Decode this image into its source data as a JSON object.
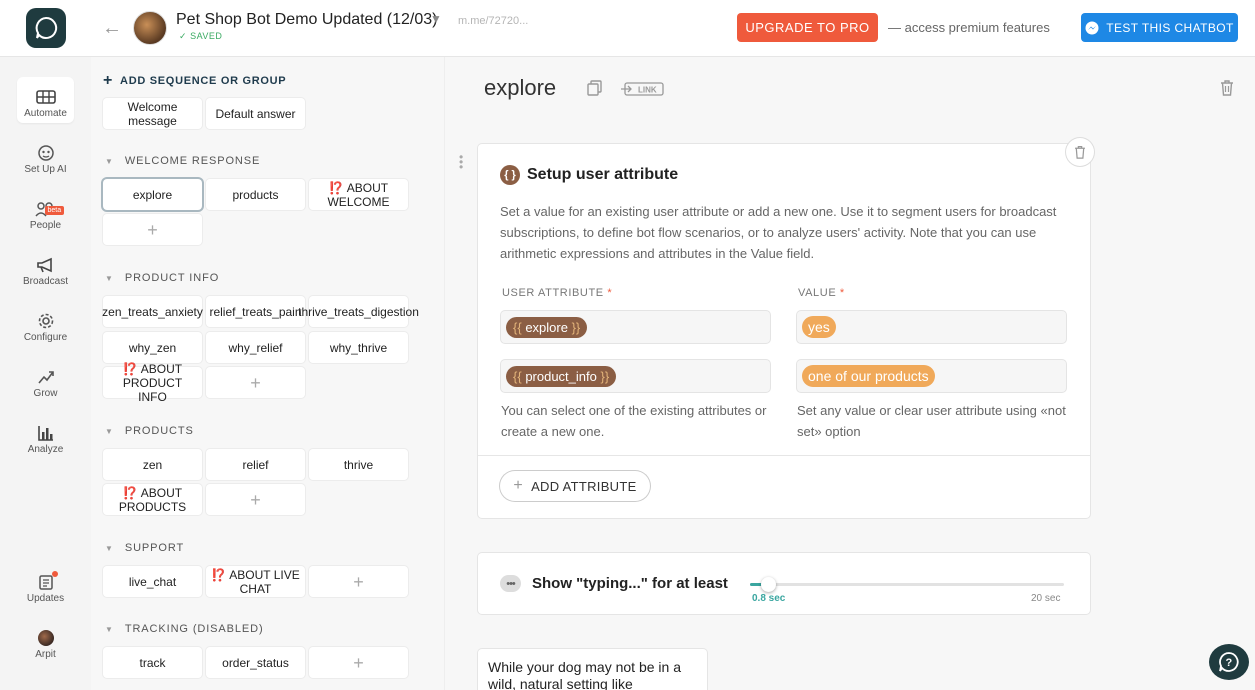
{
  "header": {
    "bot_title": "Pet Shop Bot Demo Updated (12/03)",
    "saved": "SAVED",
    "bot_link": "m.me/72720...",
    "upgrade_label": "UPGRADE TO PRO",
    "premium_text": "— access premium features",
    "test_label": "TEST THIS CHATBOT"
  },
  "rail": {
    "items": [
      {
        "label": "Automate",
        "icon": "automate-icon"
      },
      {
        "label": "Set Up AI",
        "icon": "ai-icon"
      },
      {
        "label": "People",
        "icon": "people-icon",
        "badge": "beta"
      },
      {
        "label": "Broadcast",
        "icon": "megaphone-icon"
      },
      {
        "label": "Configure",
        "icon": "gear-icon"
      },
      {
        "label": "Grow",
        "icon": "grow-icon"
      },
      {
        "label": "Analyze",
        "icon": "chart-icon"
      },
      {
        "label": "Updates",
        "icon": "updates-icon"
      },
      {
        "label": "Arpit",
        "icon": "user-avatar"
      }
    ]
  },
  "sidebar": {
    "add_label": "ADD SEQUENCE OR GROUP",
    "top_blocks": [
      "Welcome message",
      "Default answer"
    ],
    "groups": [
      {
        "title": "WELCOME RESPONSE",
        "blocks": [
          "explore",
          "products",
          "ABOUT WELCOME"
        ]
      },
      {
        "title": "PRODUCT INFO",
        "blocks": [
          "zen_treats_anxiety",
          "relief_treats_pain",
          "thrive_treats_digestion",
          "why_zen",
          "why_relief",
          "why_thrive",
          "ABOUT PRODUCT INFO"
        ]
      },
      {
        "title": "PRODUCTS",
        "blocks": [
          "zen",
          "relief",
          "thrive",
          "ABOUT PRODUCTS"
        ]
      },
      {
        "title": "SUPPORT",
        "blocks": [
          "live_chat",
          "ABOUT  LIVE CHAT"
        ]
      },
      {
        "title": "TRACKING (DISABLED)",
        "blocks": [
          "track",
          "order_status"
        ]
      }
    ],
    "warn_glyph": "⁉️"
  },
  "main": {
    "block_title": "explore",
    "link_label": "LINK",
    "attr_card": {
      "title": "Setup user attribute",
      "description": "Set a value for an existing user attribute or add a new one. Use it to segment users for broadcast subscriptions, to define bot flow scenarios, or to analyze users' activity. Note that you can use arithmetic expressions and attributes in the Value field.",
      "col_attribute": "USER ATTRIBUTE",
      "col_value": "VALUE",
      "required": "*",
      "rows": [
        {
          "attribute": "explore",
          "value": "yes"
        },
        {
          "attribute": "product_info",
          "value": "one of our products"
        }
      ],
      "help_attribute": "You can select one of the existing attributes or create a new one.",
      "help_value": "Set any value or clear user attribute using «not set» option",
      "add_label": "ADD ATTRIBUTE"
    },
    "typing_card": {
      "label": "Show \"typing...\" for at least",
      "min_label": "0.8 sec",
      "max_label": "20 sec",
      "value": 0.8,
      "min": 0,
      "max": 20
    },
    "text_card": {
      "text": "While your dog may not be in a wild, natural setting like"
    }
  }
}
